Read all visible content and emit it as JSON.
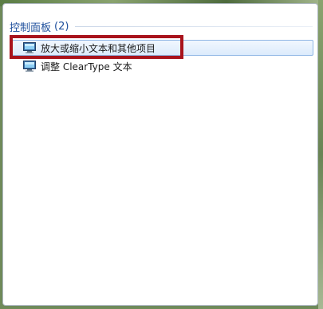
{
  "search_results": {
    "group": {
      "title": "控制面板",
      "count": "(2)"
    },
    "items": [
      {
        "label": "放大或缩小文本和其他项目",
        "icon": "display-settings-icon",
        "selected": true
      },
      {
        "label": "调整 ClearType 文本",
        "icon": "display-settings-icon",
        "selected": false
      }
    ]
  },
  "colors": {
    "group_title": "#1e4f9c",
    "selection_fill": "#dcebfc",
    "selection_border": "#8fb6e5",
    "annotation_box": "#a8131c"
  }
}
